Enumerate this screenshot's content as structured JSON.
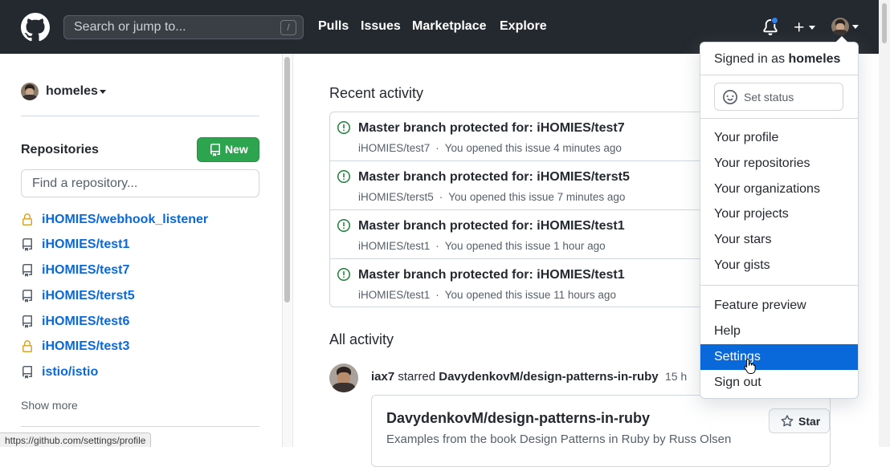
{
  "header": {
    "search_placeholder": "Search or jump to...",
    "search_shortcut": "/",
    "nav": [
      "Pulls",
      "Issues",
      "Marketplace",
      "Explore"
    ],
    "notification_dot_color": "#2f81f7"
  },
  "sidebar": {
    "username": "homeles",
    "repositories_title": "Repositories",
    "new_button": "New",
    "find_placeholder": "Find a repository...",
    "repos": [
      {
        "name": "iHOMIES/webhook_listener",
        "icon": "lock-icon"
      },
      {
        "name": "iHOMIES/test1",
        "icon": "repo-icon"
      },
      {
        "name": "iHOMIES/test7",
        "icon": "repo-icon"
      },
      {
        "name": "iHOMIES/terst5",
        "icon": "repo-icon"
      },
      {
        "name": "iHOMIES/test6",
        "icon": "repo-icon"
      },
      {
        "name": "iHOMIES/test3",
        "icon": "lock-icon"
      },
      {
        "name": "istio/istio",
        "icon": "repo-icon"
      }
    ],
    "show_more": "Show more"
  },
  "main": {
    "recent_title": "Recent activity",
    "recent": [
      {
        "title": "Master branch protected for: iHOMIES/test7",
        "repo": "iHOMIES/test7",
        "dot": "·",
        "meta": "You opened this issue 4 minutes ago"
      },
      {
        "title": "Master branch protected for: iHOMIES/terst5",
        "repo": "iHOMIES/terst5",
        "dot": "·",
        "meta": "You opened this issue 7 minutes ago"
      },
      {
        "title": "Master branch protected for: iHOMIES/test1",
        "repo": "iHOMIES/test1",
        "dot": "·",
        "meta": "You opened this issue 1 hour ago"
      },
      {
        "title": "Master branch protected for: iHOMIES/test1",
        "repo": "iHOMIES/test1",
        "dot": "·",
        "meta": "You opened this issue 11 hours ago"
      }
    ],
    "all_title": "All activity",
    "feed": {
      "actor": "iax7",
      "action": "starred",
      "target": "DavydenkovM/design-patterns-in-ruby",
      "time": "15 h"
    },
    "card": {
      "title": "DavydenkovM/design-patterns-in-ruby",
      "description": "Examples from the book Design Patterns in Ruby by Russ Olsen",
      "star_label": "Star"
    }
  },
  "dropdown": {
    "signed_in_prefix": "Signed in as",
    "signed_in_user": "homeles",
    "set_status": "Set status",
    "items_group1": [
      "Your profile",
      "Your repositories",
      "Your organizations",
      "Your projects",
      "Your stars",
      "Your gists"
    ],
    "items_group2": [
      "Feature preview",
      "Help",
      "Settings",
      "Sign out"
    ],
    "active_item": "Settings"
  },
  "statusbar": {
    "url": "https://github.com/settings/profile"
  },
  "colors": {
    "header_bg": "#24292f",
    "link_blue": "#0969da",
    "new_green": "#2da44e",
    "lock_gold": "#d4a72c",
    "issue_green": "#1a7f37",
    "active_blue": "#0969da"
  }
}
